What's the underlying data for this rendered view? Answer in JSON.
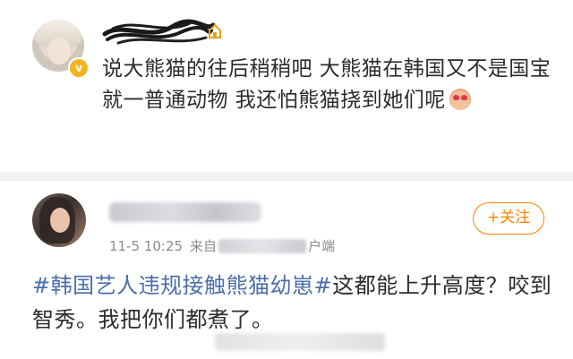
{
  "post1": {
    "avatar_badge": "v",
    "text": "说大熊猫的往后稍稍吧 大熊猫在韩国又不是国宝 就一普通动物 我还怕熊猫挠到她们呢",
    "emoji": "heart-eyes-emoji"
  },
  "post2": {
    "time": "11-5 10:25",
    "source_prefix": "来自",
    "source_suffix": "户端",
    "follow_label": "+关注",
    "topic": "#韩国艺人违规接触熊猫幼崽#",
    "text": "这都能上升高度？咬到智秀。我把你们都煮了。"
  },
  "colors": {
    "follow": "#ff8200",
    "topic": "#4a6ea9",
    "text": "#2b2b2b",
    "meta": "#8b8b8b",
    "verified_badge": "#f5b323"
  }
}
